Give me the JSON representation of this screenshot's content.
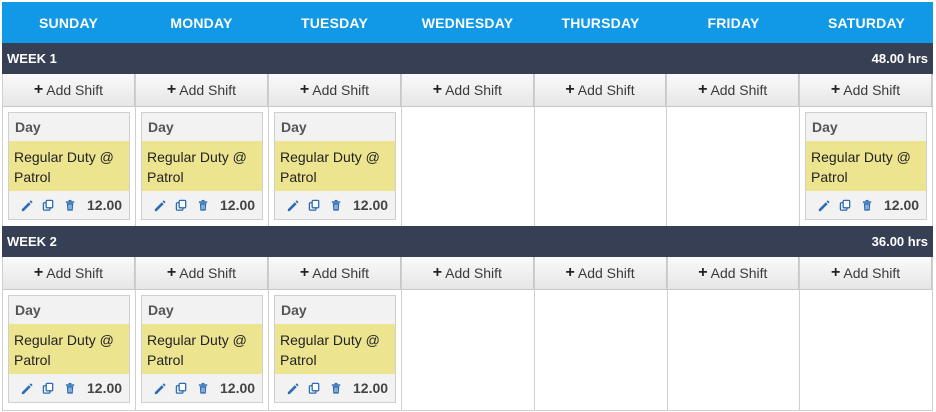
{
  "days": [
    "SUNDAY",
    "MONDAY",
    "TUESDAY",
    "WEDNESDAY",
    "THURSDAY",
    "FRIDAY",
    "SATURDAY"
  ],
  "add_label": "Add Shift",
  "colors": {
    "header": "#1199e8",
    "week_bar": "#363f54",
    "shift_highlight": "#ece48f",
    "icon": "#2b6cb3"
  },
  "weeks": [
    {
      "label": "WEEK 1",
      "total": "48.00 hrs",
      "cells": [
        {
          "shift": {
            "title": "Day",
            "line1": "Regular Duty @",
            "line2": "Patrol",
            "hours": "12.00"
          }
        },
        {
          "shift": {
            "title": "Day",
            "line1": "Regular Duty @",
            "line2": "Patrol",
            "hours": "12.00"
          }
        },
        {
          "shift": {
            "title": "Day",
            "line1": "Regular Duty @",
            "line2": "Patrol",
            "hours": "12.00"
          }
        },
        {
          "shift": null
        },
        {
          "shift": null
        },
        {
          "shift": null
        },
        {
          "shift": {
            "title": "Day",
            "line1": "Regular Duty @",
            "line2": "Patrol",
            "hours": "12.00"
          }
        }
      ]
    },
    {
      "label": "WEEK 2",
      "total": "36.00 hrs",
      "cells": [
        {
          "shift": {
            "title": "Day",
            "line1": "Regular Duty @",
            "line2": "Patrol",
            "hours": "12.00"
          }
        },
        {
          "shift": {
            "title": "Day",
            "line1": "Regular Duty @",
            "line2": "Patrol",
            "hours": "12.00"
          }
        },
        {
          "shift": {
            "title": "Day",
            "line1": "Regular Duty @",
            "line2": "Patrol",
            "hours": "12.00"
          }
        },
        {
          "shift": null
        },
        {
          "shift": null
        },
        {
          "shift": null
        },
        {
          "shift": null
        }
      ]
    }
  ]
}
